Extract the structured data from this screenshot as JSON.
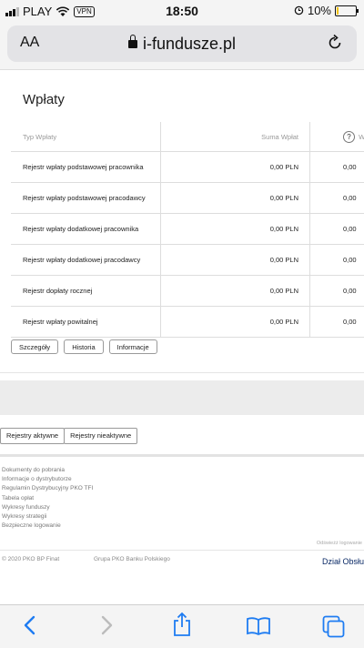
{
  "status": {
    "carrier": "PLAY",
    "vpn": "VPN",
    "time": "18:50",
    "battery": "10%"
  },
  "browser": {
    "text_size": "AA",
    "url": "i-fundusze.pl"
  },
  "payments": {
    "title": "Wpłaty",
    "columns": [
      "Typ Wpłaty",
      "Suma Wpłat",
      "W"
    ],
    "rows": [
      {
        "type": "Rejestr wpłaty podstawowej pracownika",
        "sum": "0,00 PLN",
        "next": "0,00"
      },
      {
        "type": "Rejestr wpłaty podstawowej pracodawcy",
        "sum": "0,00 PLN",
        "next": "0,00"
      },
      {
        "type": "Rejestr wpłaty dodatkowej pracownika",
        "sum": "0,00 PLN",
        "next": "0,00"
      },
      {
        "type": "Rejestr wpłaty dodatkowej pracodawcy",
        "sum": "0,00 PLN",
        "next": "0,00"
      },
      {
        "type": "Rejestr dopłaty rocznej",
        "sum": "0,00 PLN",
        "next": "0,00"
      },
      {
        "type": "Rejestr wpłaty powitalnej",
        "sum": "0,00 PLN",
        "next": "0,00"
      }
    ],
    "buttons": {
      "details": "Szczegóły",
      "history": "Historia",
      "info": "Informacje"
    }
  },
  "registers": {
    "active": "Rejestry aktywne",
    "inactive": "Rejestry nieaktywne"
  },
  "footer": {
    "links": [
      "Dokumenty do pobrania",
      "Informacje o dystrybutorze",
      "Regulamin Dystrybucyjny PKO TFI",
      "Tabela opłat",
      "Wykresy funduszy",
      "Wykresy strategii",
      "Bezpieczne logowanie"
    ],
    "logout": "Odświeżż logowanie",
    "copyright": "© 2020 PKO BP Finat",
    "group": "Grupa PKO Banku Polskiego",
    "service": "Dział Obsłu"
  },
  "colors": {
    "brand_navy": "#0b2a66",
    "ios_blue": "#1e7cf2"
  },
  "icons": [
    "signal-icon",
    "wifi-icon",
    "alarm-icon",
    "battery-icon",
    "lock-icon",
    "reload-icon",
    "back-icon",
    "forward-icon",
    "share-icon",
    "bookmarks-icon",
    "tabs-icon",
    "help-icon"
  ]
}
